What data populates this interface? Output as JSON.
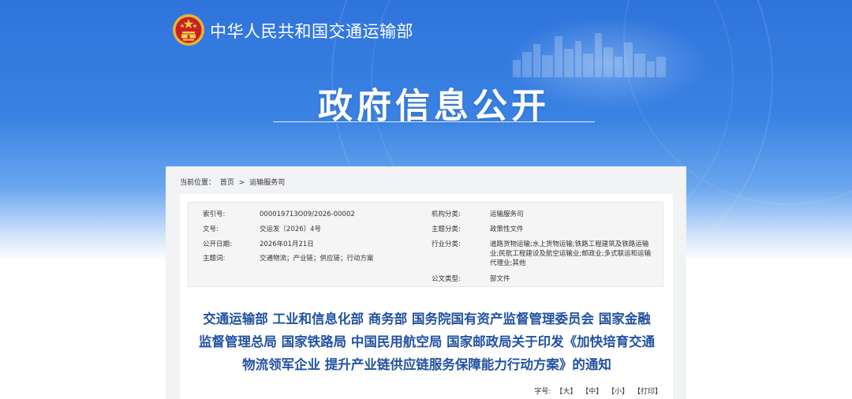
{
  "header": {
    "ministry_name": "中华人民共和国交通运输部",
    "page_title": "政府信息公开",
    "emblem_icon": "national-emblem-icon",
    "colors": {
      "hero_blue": "#2f74dc",
      "title_blue": "#2353a1"
    }
  },
  "breadcrumb": {
    "label": "当前位置：",
    "items": [
      "首页",
      ">",
      "运输服务司"
    ]
  },
  "meta": {
    "index_label": "索引号:",
    "index_value": "000019713O09/2026-00002",
    "org_label": "机构分类:",
    "org_value": "运输服务司",
    "doc_no_label": "文号:",
    "doc_no_value": "交运发〔2026〕4号",
    "topic_label": "主题分类:",
    "topic_value": "政策性文件",
    "date_label": "公开日期:",
    "date_value": "2026年01月21日",
    "industry_label": "行业分类:",
    "industry_value": "道路货物运输;水上货物运输;铁路工程建筑及铁路运输业;民航工程建设及航空运输业;邮政业;多式联运和运输代理业;其他",
    "keywords_label": "主题词:",
    "keywords_value": "交通物流；产业链；供应链；行动方案",
    "doc_type_label": "公文类型:",
    "doc_type_value": "部文件"
  },
  "document": {
    "title": "交通运输部 工业和信息化部 商务部 国务院国有资产监督管理委员会 国家金融监督管理总局 国家铁路局 中国民用航空局 国家邮政局关于印发《加快培育交通物流领军企业 提升产业链供应链服务保障能力行动方案》的通知"
  },
  "font_size": {
    "label": "字号:",
    "large": "【大】",
    "medium": "【中】",
    "small": "【小】",
    "print": "【打印】"
  }
}
